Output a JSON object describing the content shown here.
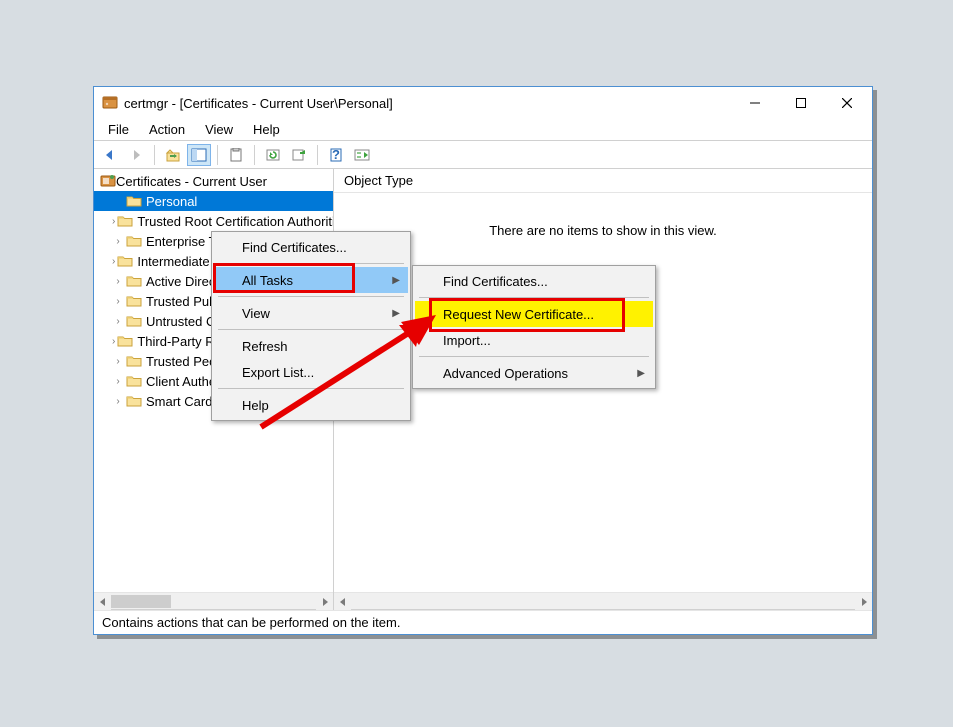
{
  "title": "certmgr - [Certificates - Current User\\Personal]",
  "menubar": {
    "file": "File",
    "action": "Action",
    "view": "View",
    "help": "Help"
  },
  "tree": {
    "root": "Certificates - Current User",
    "children": [
      "Personal",
      "Trusted Root Certification Authorities",
      "Enterprise Trust",
      "Intermediate Certification Authorities",
      "Active Directory User Object",
      "Trusted Publishers",
      "Untrusted Certificates",
      "Third-Party Root Certification Authorities",
      "Trusted People",
      "Client Authentication Issuers",
      "Smart Card Trusted Roots"
    ]
  },
  "list": {
    "header": "Object Type",
    "empty": "There are no items to show in this view."
  },
  "context1": {
    "find": "Find Certificates...",
    "all_tasks": "All Tasks",
    "view": "View",
    "refresh": "Refresh",
    "export": "Export List...",
    "help": "Help"
  },
  "context2": {
    "find": "Find Certificates...",
    "request": "Request New Certificate...",
    "import": "Import...",
    "advanced": "Advanced Operations"
  },
  "statusbar": "Contains actions that can be performed on the item."
}
